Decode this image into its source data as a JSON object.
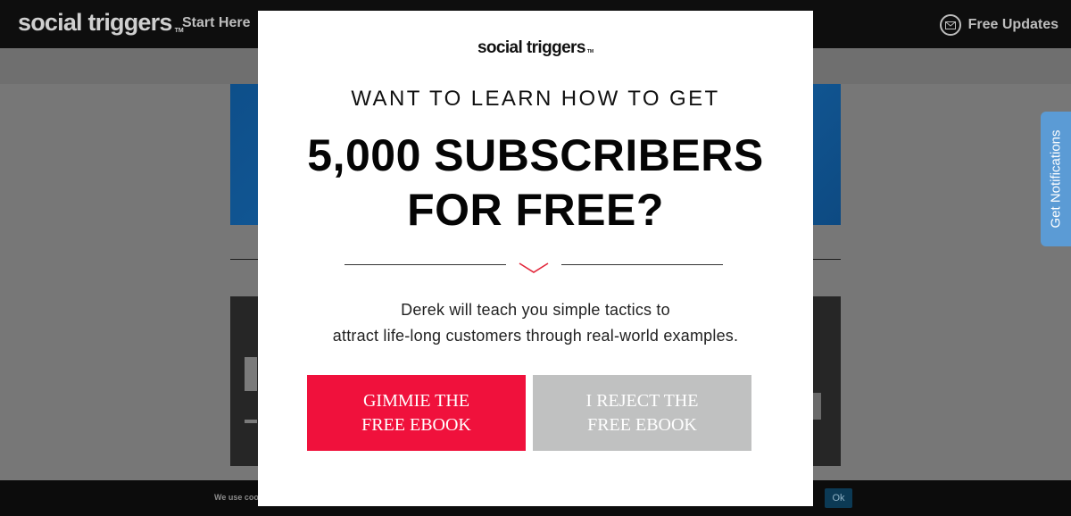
{
  "nav": {
    "logo": "social triggers",
    "logo_tm": "TM",
    "start_here": "Start Here",
    "free_updates": "Free Updates"
  },
  "cookie": {
    "text": "We use coo",
    "ok_label": "Ok"
  },
  "notifications_tab": {
    "label": "Get Notifications"
  },
  "modal": {
    "logo": "social triggers",
    "logo_tm": "TM",
    "eyebrow": "WANT TO LEARN HOW TO GET",
    "headline_line1": "5,000 SUBSCRIBERS",
    "headline_line2": "FOR FREE?",
    "desc_line1": "Derek will teach you simple tactics to",
    "desc_line2": "attract life-long customers through real-world examples.",
    "accept_button": "GIMMIE THE FREE EBOOK",
    "reject_button": "I REJECT THE FREE EBOOK"
  },
  "colors": {
    "accept": "#f0113c",
    "reject": "#c0c1c1",
    "notifications": "#5b9bd5",
    "chevron": "#e2263a"
  },
  "icons": {
    "mail": "mail-icon",
    "chevron": "chevron-down-icon"
  }
}
